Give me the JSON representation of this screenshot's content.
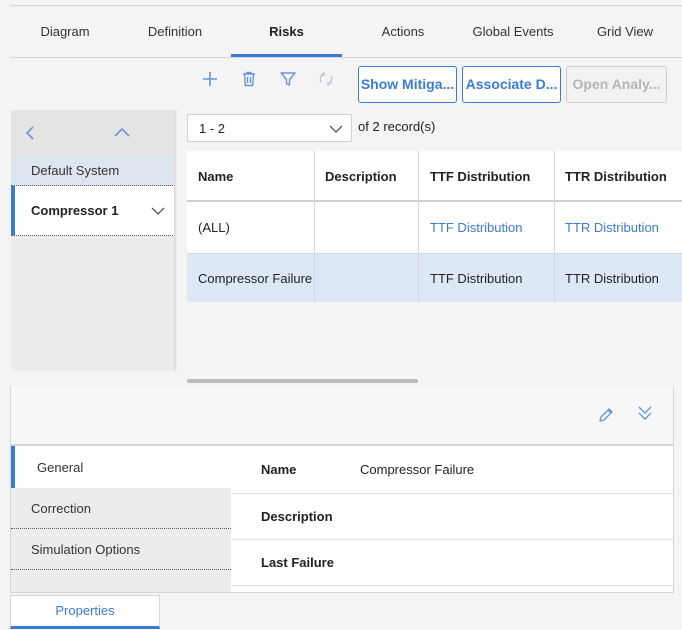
{
  "top_tabs": [
    {
      "label": "Diagram"
    },
    {
      "label": "Definition"
    },
    {
      "label": "Risks"
    },
    {
      "label": "Actions"
    },
    {
      "label": "Global Events"
    },
    {
      "label": "Grid View"
    }
  ],
  "active_tab": "Risks",
  "toolbar": {
    "icons": [
      "plus-icon",
      "trash-icon",
      "filter-icon",
      "refresh-icon"
    ],
    "show_mitigation_label": "Show Mitiga...",
    "associate_label": "Associate D...",
    "open_analysis_label": "Open Analy..."
  },
  "left_nav": {
    "items": [
      {
        "label": "Default System"
      },
      {
        "label": "Compressor 1"
      }
    ]
  },
  "pager": {
    "range": "1 - 2",
    "of_label": "of",
    "total": "2",
    "records_label": "record(s)"
  },
  "grid": {
    "columns": [
      "Name",
      "Description",
      "TTF Distribution",
      "TTR Distribution"
    ],
    "rows": [
      {
        "name": "(ALL)",
        "description": "",
        "ttf": "TTF Distribution",
        "ttr": "TTR Distribution"
      },
      {
        "name": "Compressor Failure",
        "description": "",
        "ttf": "TTF Distribution",
        "ttr": "TTR Distribution"
      }
    ]
  },
  "detail": {
    "side_tabs": [
      {
        "label": "General"
      },
      {
        "label": "Correction"
      },
      {
        "label": "Simulation Options"
      }
    ],
    "properties": [
      {
        "label": "Name",
        "value": "Compressor Failure"
      },
      {
        "label": "Description",
        "value": ""
      },
      {
        "label": "Last Failure",
        "value": ""
      }
    ]
  },
  "bottom_tab": {
    "label": "Properties"
  },
  "colors": {
    "accent": "#3a7bd5",
    "selected_row": "#dde8f6"
  }
}
